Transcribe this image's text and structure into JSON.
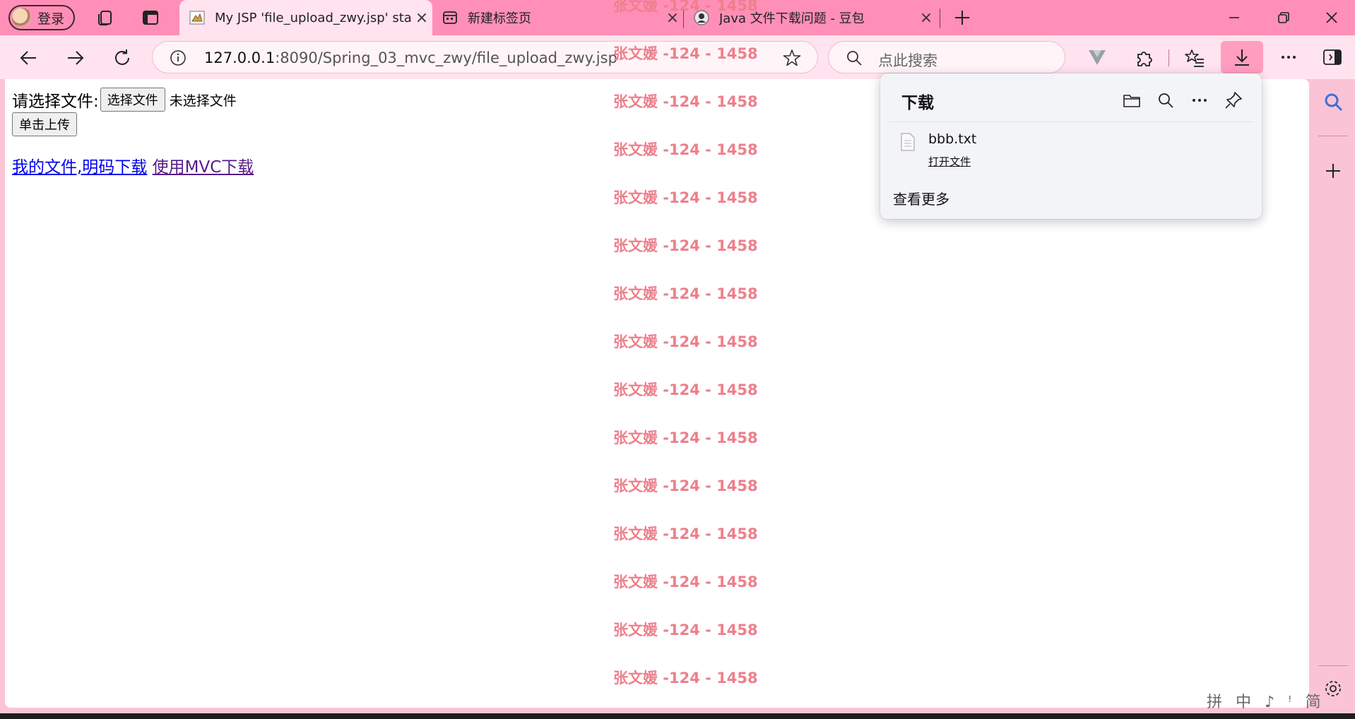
{
  "browser": {
    "profile": {
      "label": "登录"
    },
    "tabs": [
      {
        "title": "My JSP 'file_upload_zwy.jsp' startin",
        "active": true
      },
      {
        "title": "新建标签页",
        "active": false
      },
      {
        "title": "Java 文件下载问题 - 豆包",
        "active": false
      }
    ],
    "address": {
      "host": "127.0.0.1",
      "rest": ":8090/Spring_03_mvc_zwy/file_upload_zwy.jsp"
    },
    "search": {
      "placeholder": "点此搜索"
    }
  },
  "page": {
    "file_label": "请选择文件:",
    "choose_button": "选择文件",
    "no_file": "未选择文件",
    "upload_button": "单击上传",
    "links": [
      {
        "text": "我的文件,明码下载",
        "visited": false
      },
      {
        "text": "使用MVC下载",
        "visited": true
      }
    ]
  },
  "watermark": {
    "text": "张文媛 -124 - 1458"
  },
  "downloads": {
    "title": "下载",
    "items": [
      {
        "name": "bbb.txt",
        "action": "打开文件"
      }
    ],
    "see_more": "查看更多"
  },
  "ime": {
    "text": "拼 中 ♪ ꜝ 简"
  },
  "colors": {
    "tabstrip": "#ff8fb6",
    "toolbar": "#ffe3ee",
    "frame": "#fbc4d6",
    "watermark": "#ee7f8c",
    "link": "#0000ee",
    "visited_link": "#551a8b"
  }
}
